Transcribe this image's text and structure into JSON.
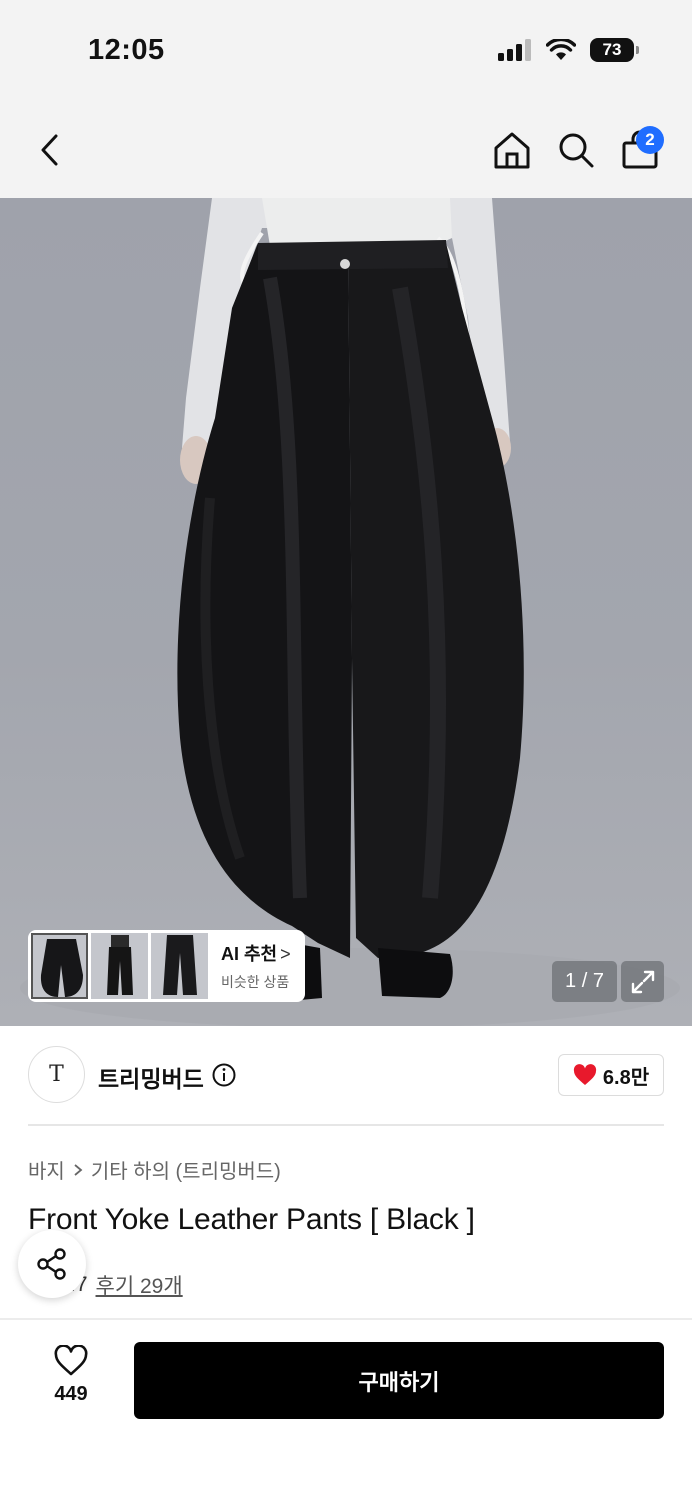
{
  "status_bar": {
    "time": "12:05",
    "battery": "73"
  },
  "nav": {
    "cart_count": "2"
  },
  "gallery": {
    "ai_title": "AI 추천",
    "ai_subtitle": "비슷한 상품",
    "page_current": "1",
    "page_total": "7"
  },
  "brand": {
    "name": "트리밍버드",
    "logo_text": "T",
    "likes": "6.8만"
  },
  "product": {
    "breadcrumb": [
      "바지",
      "기타 하의 (트리밍버드)"
    ],
    "title": "Front Yoke Leather Pants [ Black ]",
    "rating": ".7",
    "reviews": "후기 29개"
  },
  "bottom_bar": {
    "wish_count": "449",
    "buy_label": "구매하기"
  },
  "colors": {
    "badge": "#1f6dff",
    "heart": "#e8192c",
    "buy_button": "#000000"
  }
}
